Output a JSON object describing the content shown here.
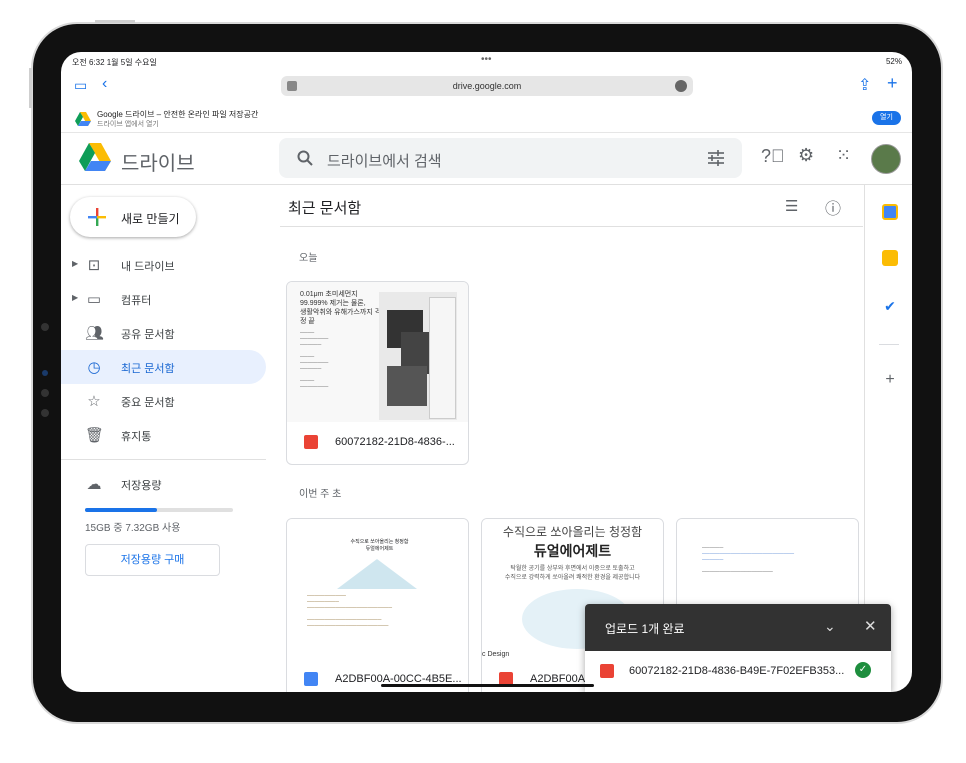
{
  "status": {
    "time": "오전 6:32 1월 5일 수요일",
    "dots": "•••",
    "right": "52%"
  },
  "safari": {
    "url": "drive.google.com"
  },
  "banner": {
    "title": "Google 드라이브 – 안전한 온라인 파일 저장공간",
    "subtitle": "드라이브 앱에서 열기",
    "open": "열기"
  },
  "header": {
    "app_name": "드라이브",
    "search_placeholder": "드라이브에서 검색"
  },
  "sidebar": {
    "new_label": "새로 만들기",
    "items": [
      {
        "label": "내 드라이브"
      },
      {
        "label": "컴퓨터"
      },
      {
        "label": "공유 문서함"
      },
      {
        "label": "최근 문서함"
      },
      {
        "label": "중요 문서함"
      },
      {
        "label": "휴지통"
      }
    ],
    "storage_label": "저장용량",
    "storage_used": "15GB 중 7.32GB 사용",
    "storage_fraction": 0.488,
    "buy_label": "저장용량 구매"
  },
  "main": {
    "title": "최근 문서함",
    "section_today": "오늘",
    "section_week": "이번 주 초",
    "today_files": [
      {
        "name": "60072182-21D8-4836-...",
        "thumb_title": "0.01μm 초미세먼지\n99.999% 제거는 물론,\n생활악취와 유해가스까지 걱정 끝"
      }
    ],
    "week_files": [
      {
        "name": "A2DBF00A-00CC-4B5E...",
        "thumb_title": "수직으로 쏘아올리는 청정함\n듀얼에어제트"
      },
      {
        "name": "A2DBF00A",
        "thumb_title": "수직으로 쏘아올리는 청정함",
        "thumb_sub": "듀얼에어제트",
        "thumb_body": "탁월한 공기를 상부와 후면에서 이중으로 토출하고\n수직으로 강력하게 쏘아올려 쾌적한 환경을 제공합니다",
        "thumb_tag": "c Design"
      },
      {
        "name": "",
        "thumb_title": ""
      }
    ]
  },
  "upload": {
    "title": "업로드 1개 완료",
    "file": "60072182-21D8-4836-B49E-7F02EFB353..."
  }
}
